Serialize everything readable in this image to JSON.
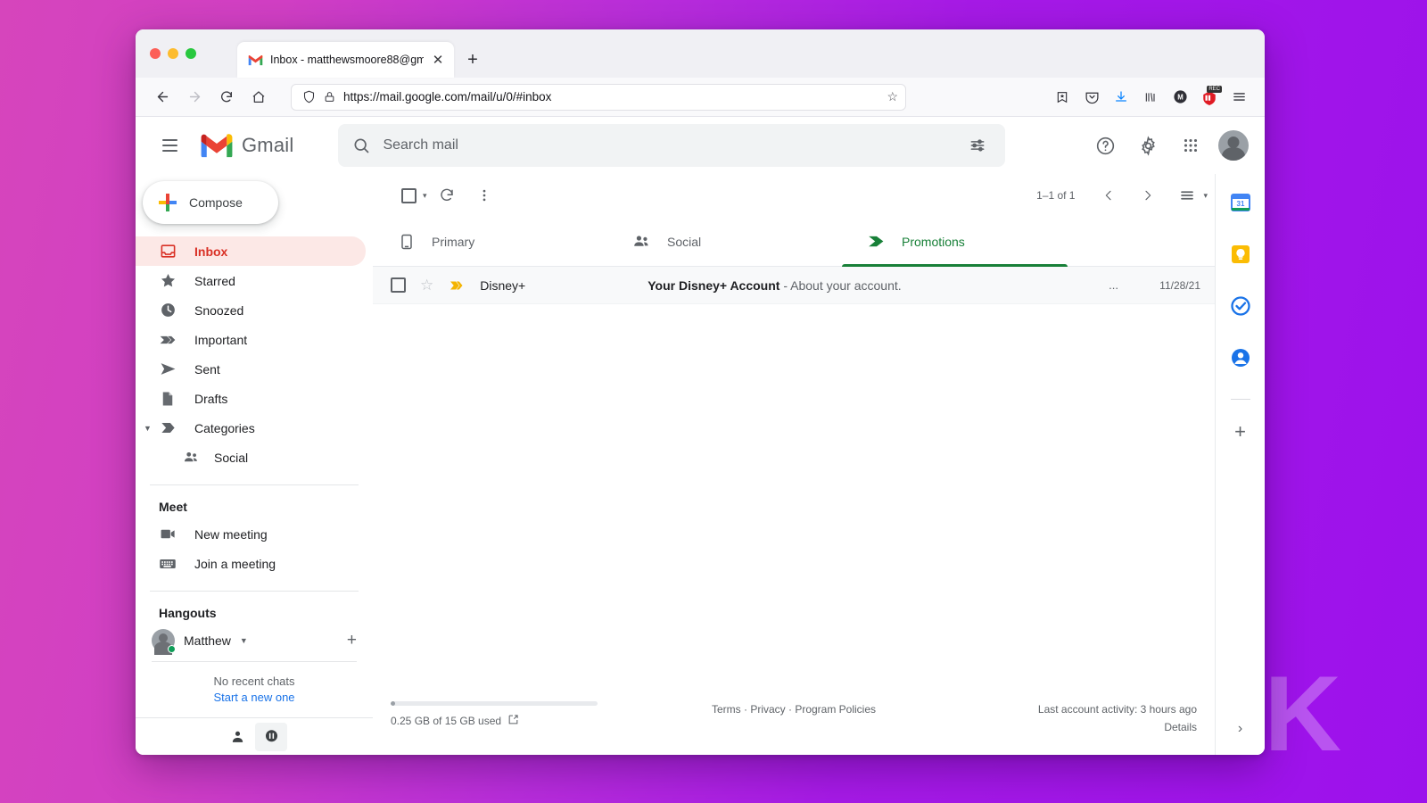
{
  "browser": {
    "tab": {
      "title": "Inbox - matthewsmoore88@gm",
      "favicon": "gmail-icon",
      "close_label": "✕"
    },
    "new_tab_label": "+",
    "nav": {
      "back": "←",
      "forward": "→",
      "reload": "↻",
      "home": "⌂"
    },
    "url": "https://mail.google.com/mail/u/0/#inbox",
    "url_icons": [
      "shield-icon",
      "lock-icon"
    ],
    "bookmark_star": "☆",
    "toolbar_icons": [
      "pocket-save-icon",
      "pocket-icon",
      "downloads-icon",
      "library-icon",
      "account-icon",
      "extension-icon",
      "app-menu-icon"
    ],
    "extension_badge": "REC"
  },
  "gmail": {
    "logo_text": "Gmail",
    "menu_label": "Main menu",
    "search": {
      "placeholder": "Search mail",
      "value": "",
      "icon": "search-icon",
      "filter_icon": "tune-icon"
    },
    "header_icons": [
      {
        "name": "help-icon",
        "glyph": "?"
      },
      {
        "name": "settings-gear-icon",
        "glyph": "⚙"
      },
      {
        "name": "google-apps-icon",
        "glyph": "∷"
      }
    ],
    "avatar_label": "Matthew"
  },
  "sidebar": {
    "compose_label": "Compose",
    "items": [
      {
        "label": "Inbox",
        "icon": "inbox-icon",
        "active": true
      },
      {
        "label": "Starred",
        "icon": "star-icon",
        "active": false
      },
      {
        "label": "Snoozed",
        "icon": "clock-icon",
        "active": false
      },
      {
        "label": "Important",
        "icon": "important-chevron-icon",
        "active": false
      },
      {
        "label": "Sent",
        "icon": "send-icon",
        "active": false
      },
      {
        "label": "Drafts",
        "icon": "draft-icon",
        "active": false
      },
      {
        "label": "Categories",
        "icon": "label-icon",
        "active": false,
        "expandable": true
      },
      {
        "label": "Social",
        "icon": "people-icon",
        "active": false,
        "sub": true
      }
    ],
    "meet": {
      "title": "Meet",
      "items": [
        {
          "label": "New meeting",
          "icon": "video-camera-icon"
        },
        {
          "label": "Join a meeting",
          "icon": "keyboard-icon"
        }
      ]
    },
    "hangouts": {
      "title": "Hangouts",
      "user_name": "Matthew",
      "status": "online",
      "add_label": "+",
      "empty_text": "No recent chats",
      "start_link": "Start a new one"
    },
    "footer_icons": [
      {
        "name": "contacts-person-icon",
        "selected": false
      },
      {
        "name": "hangouts-chat-icon",
        "selected": true
      }
    ]
  },
  "toolbar": {
    "select_all_icon": "checkbox-icon",
    "select_caret": "▾",
    "refresh_icon": "refresh-icon",
    "more_icon": "more-vertical-icon",
    "page_range": "1–1 of 1",
    "prev_icon": "‹",
    "next_icon": "›",
    "density_icon": "list-density-icon",
    "density_caret": "▾"
  },
  "mail_tabs": [
    {
      "label": "Primary",
      "icon": "inbox-tab-icon",
      "active": false
    },
    {
      "label": "Social",
      "icon": "people-tab-icon",
      "active": false
    },
    {
      "label": "Promotions",
      "icon": "tag-icon",
      "active": true
    }
  ],
  "emails": [
    {
      "sender": "Disney+",
      "subject": "Your Disney+ Account",
      "snippet": " - About your account.",
      "attachment": "...",
      "date": "11/28/21",
      "starred": false,
      "important": true,
      "read": true
    }
  ],
  "footer": {
    "storage_text": "0.25 GB of 15 GB used",
    "storage_percent": 1.7,
    "open_icon": "external-link-icon",
    "links": "Terms · Privacy · Program Policies",
    "activity": "Last account activity: 3 hours ago",
    "details": "Details"
  },
  "right_rail": {
    "icons": [
      {
        "name": "google-calendar-icon",
        "label": "31"
      },
      {
        "name": "google-keep-icon",
        "label": ""
      },
      {
        "name": "google-tasks-icon",
        "label": ""
      },
      {
        "name": "google-contacts-icon",
        "label": ""
      }
    ],
    "add_label": "+",
    "expand_icon": "›"
  },
  "watermark": {
    "text": "K"
  },
  "colors": {
    "gmail_red": "#d93025",
    "inbox_highlight": "#fce8e6",
    "promotions_green": "#188038",
    "link_blue": "#1a73e8",
    "bg_pink": "#d645bc",
    "bg_purple": "#9c11ec"
  }
}
